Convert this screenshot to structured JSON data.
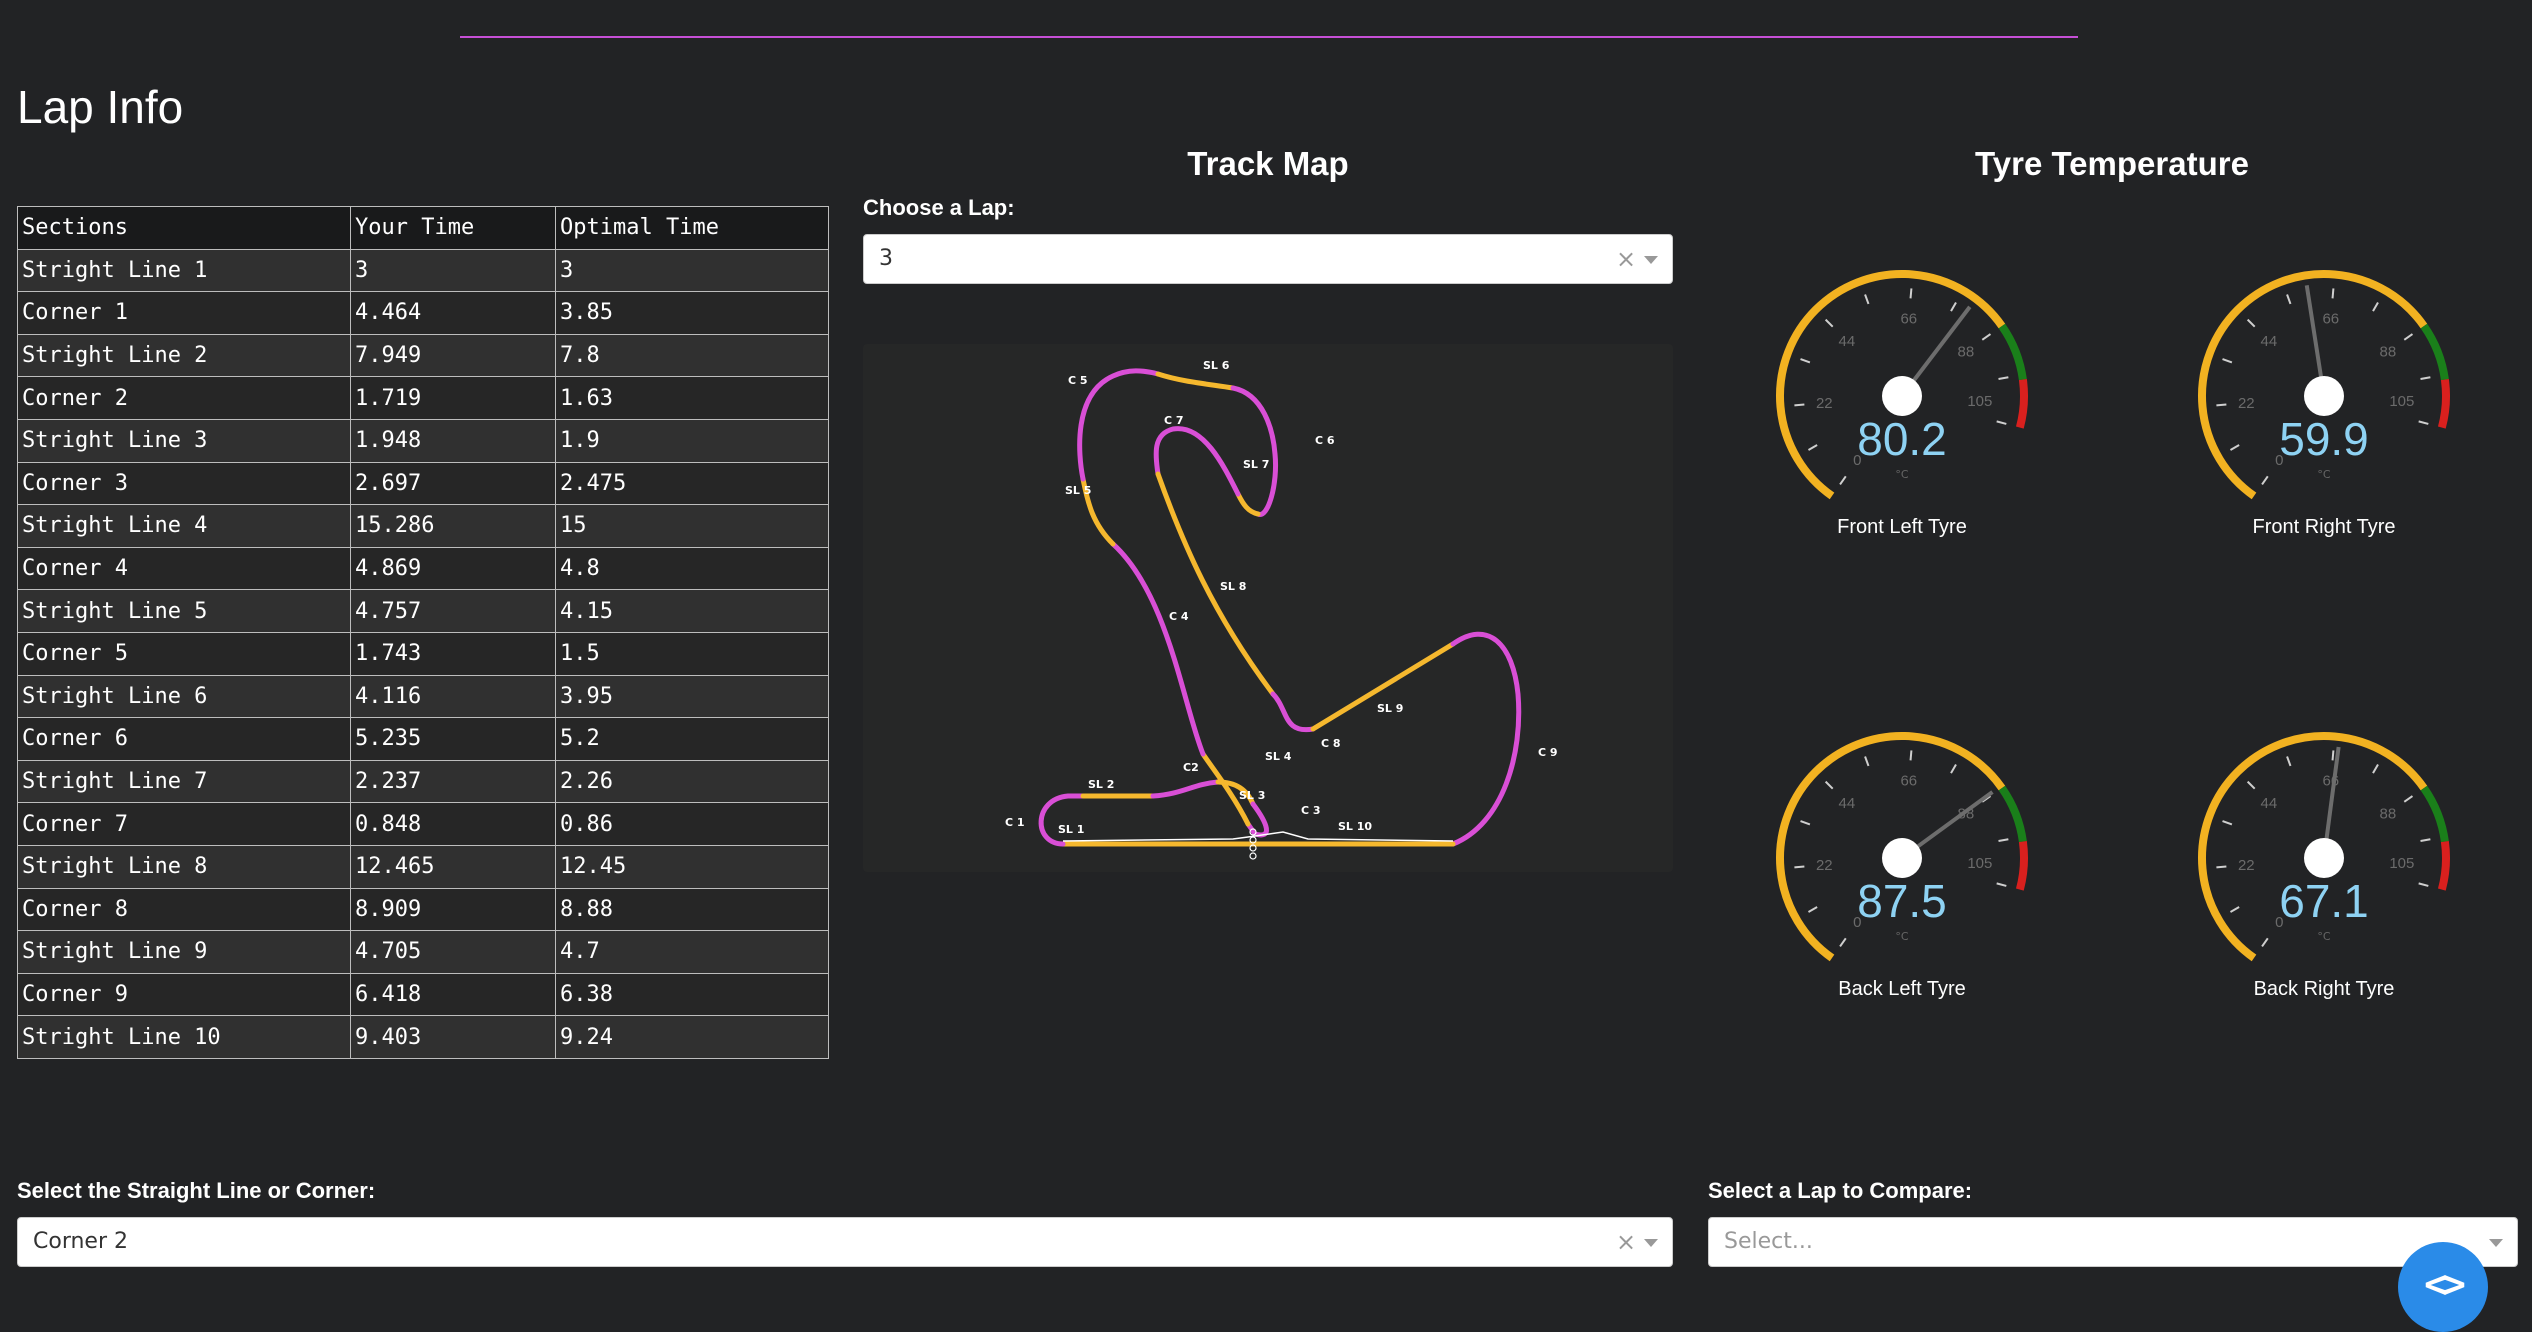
{
  "page": {
    "title": "Lap Info"
  },
  "lap_table": {
    "headers": [
      "Sections",
      "Your Time",
      "Optimal Time"
    ],
    "rows": [
      [
        "Stright Line 1",
        "3",
        "3"
      ],
      [
        "Corner 1",
        "4.464",
        "3.85"
      ],
      [
        "Stright Line 2",
        "7.949",
        "7.8"
      ],
      [
        "Corner 2",
        "1.719",
        "1.63"
      ],
      [
        "Stright Line 3",
        "1.948",
        "1.9"
      ],
      [
        "Corner 3",
        "2.697",
        "2.475"
      ],
      [
        "Stright Line 4",
        "15.286",
        "15"
      ],
      [
        "Corner 4",
        "4.869",
        "4.8"
      ],
      [
        "Stright Line 5",
        "4.757",
        "4.15"
      ],
      [
        "Corner 5",
        "1.743",
        "1.5"
      ],
      [
        "Stright Line 6",
        "4.116",
        "3.95"
      ],
      [
        "Corner 6",
        "5.235",
        "5.2"
      ],
      [
        "Stright Line 7",
        "2.237",
        "2.26"
      ],
      [
        "Corner 7",
        "0.848",
        "0.86"
      ],
      [
        "Stright Line 8",
        "12.465",
        "12.45"
      ],
      [
        "Corner 8",
        "8.909",
        "8.88"
      ],
      [
        "Stright Line 9",
        "4.705",
        "4.7"
      ],
      [
        "Corner 9",
        "6.418",
        "6.38"
      ],
      [
        "Stright Line 10",
        "9.403",
        "9.24"
      ]
    ]
  },
  "track_map": {
    "title": "Track Map",
    "lap_label": "Choose a Lap:",
    "lap_value": "3",
    "clear_icon": "×",
    "section_labels": [
      "SL 1",
      "C 1",
      "SL 2",
      "C2",
      "SL 3",
      "C 3",
      "SL 4",
      "C 4",
      "SL 5",
      "C 5",
      "SL 6",
      "C 6",
      "SL 7",
      "C 7",
      "SL 8",
      "C 8",
      "SL 9",
      "C 9",
      "SL 10"
    ],
    "colors": {
      "straight": "#f5b82e",
      "corner": "#d94fd6",
      "start_line": "#ffffff"
    }
  },
  "tyre": {
    "title": "Tyre Temperature",
    "unit": "°C",
    "scale_labels": [
      "0",
      "22",
      "44",
      "66",
      "88",
      "105"
    ],
    "gauge_range": [
      0,
      110
    ],
    "colors": {
      "normal": "#f2b221",
      "optimal": "#1a7f1a",
      "hot": "#d9201e",
      "needle": "#6d6d6d",
      "readout": "#8ed2f3"
    },
    "bands": {
      "normal_end": 88,
      "optimal_end": 100
    },
    "gauges": [
      {
        "name": "Front Left Tyre",
        "value": "80.2"
      },
      {
        "name": "Front Right Tyre",
        "value": "59.9"
      },
      {
        "name": "Back Left Tyre",
        "value": "87.5"
      },
      {
        "name": "Back Right Tyre",
        "value": "67.1"
      }
    ]
  },
  "section_select": {
    "label": "Select the Straight Line or Corner:",
    "value": "Corner 2",
    "clear_icon": "×"
  },
  "compare_select": {
    "label": "Select a Lap to Compare:",
    "placeholder": "Select..."
  },
  "fab": {
    "icon": "<>",
    "icon_name": "code-icon"
  }
}
